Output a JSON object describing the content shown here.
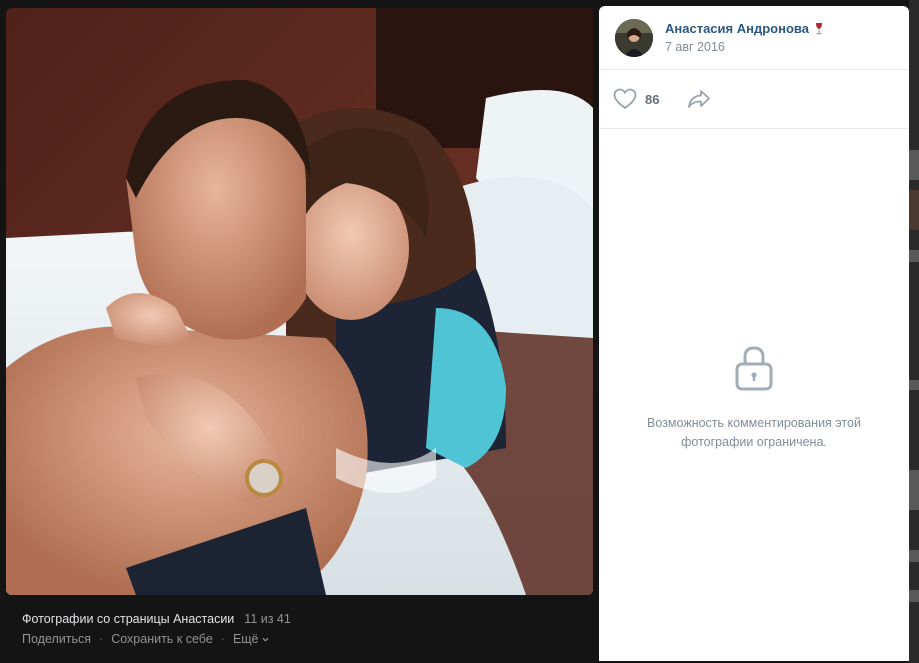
{
  "author": {
    "name": "Анастасия Андронова",
    "date": "7 авг 2016"
  },
  "actions": {
    "likes": "86"
  },
  "comments": {
    "restricted_line1": "Возможность комментирования этой",
    "restricted_line2": "фотографии ограничена."
  },
  "footer": {
    "album": "Фотографии со страницы Анастасии",
    "counter": "11 из 41",
    "share": "Поделиться",
    "save": "Сохранить к себе",
    "more": "Ещё",
    "separator": "·"
  },
  "colors": {
    "link": "#2a5885",
    "muted": "#818c99",
    "icon": "#99a2ad"
  },
  "icons": [
    "heart-icon",
    "share-arrow-icon",
    "lock-icon",
    "wine-glass-icon",
    "chevron-down-icon"
  ]
}
